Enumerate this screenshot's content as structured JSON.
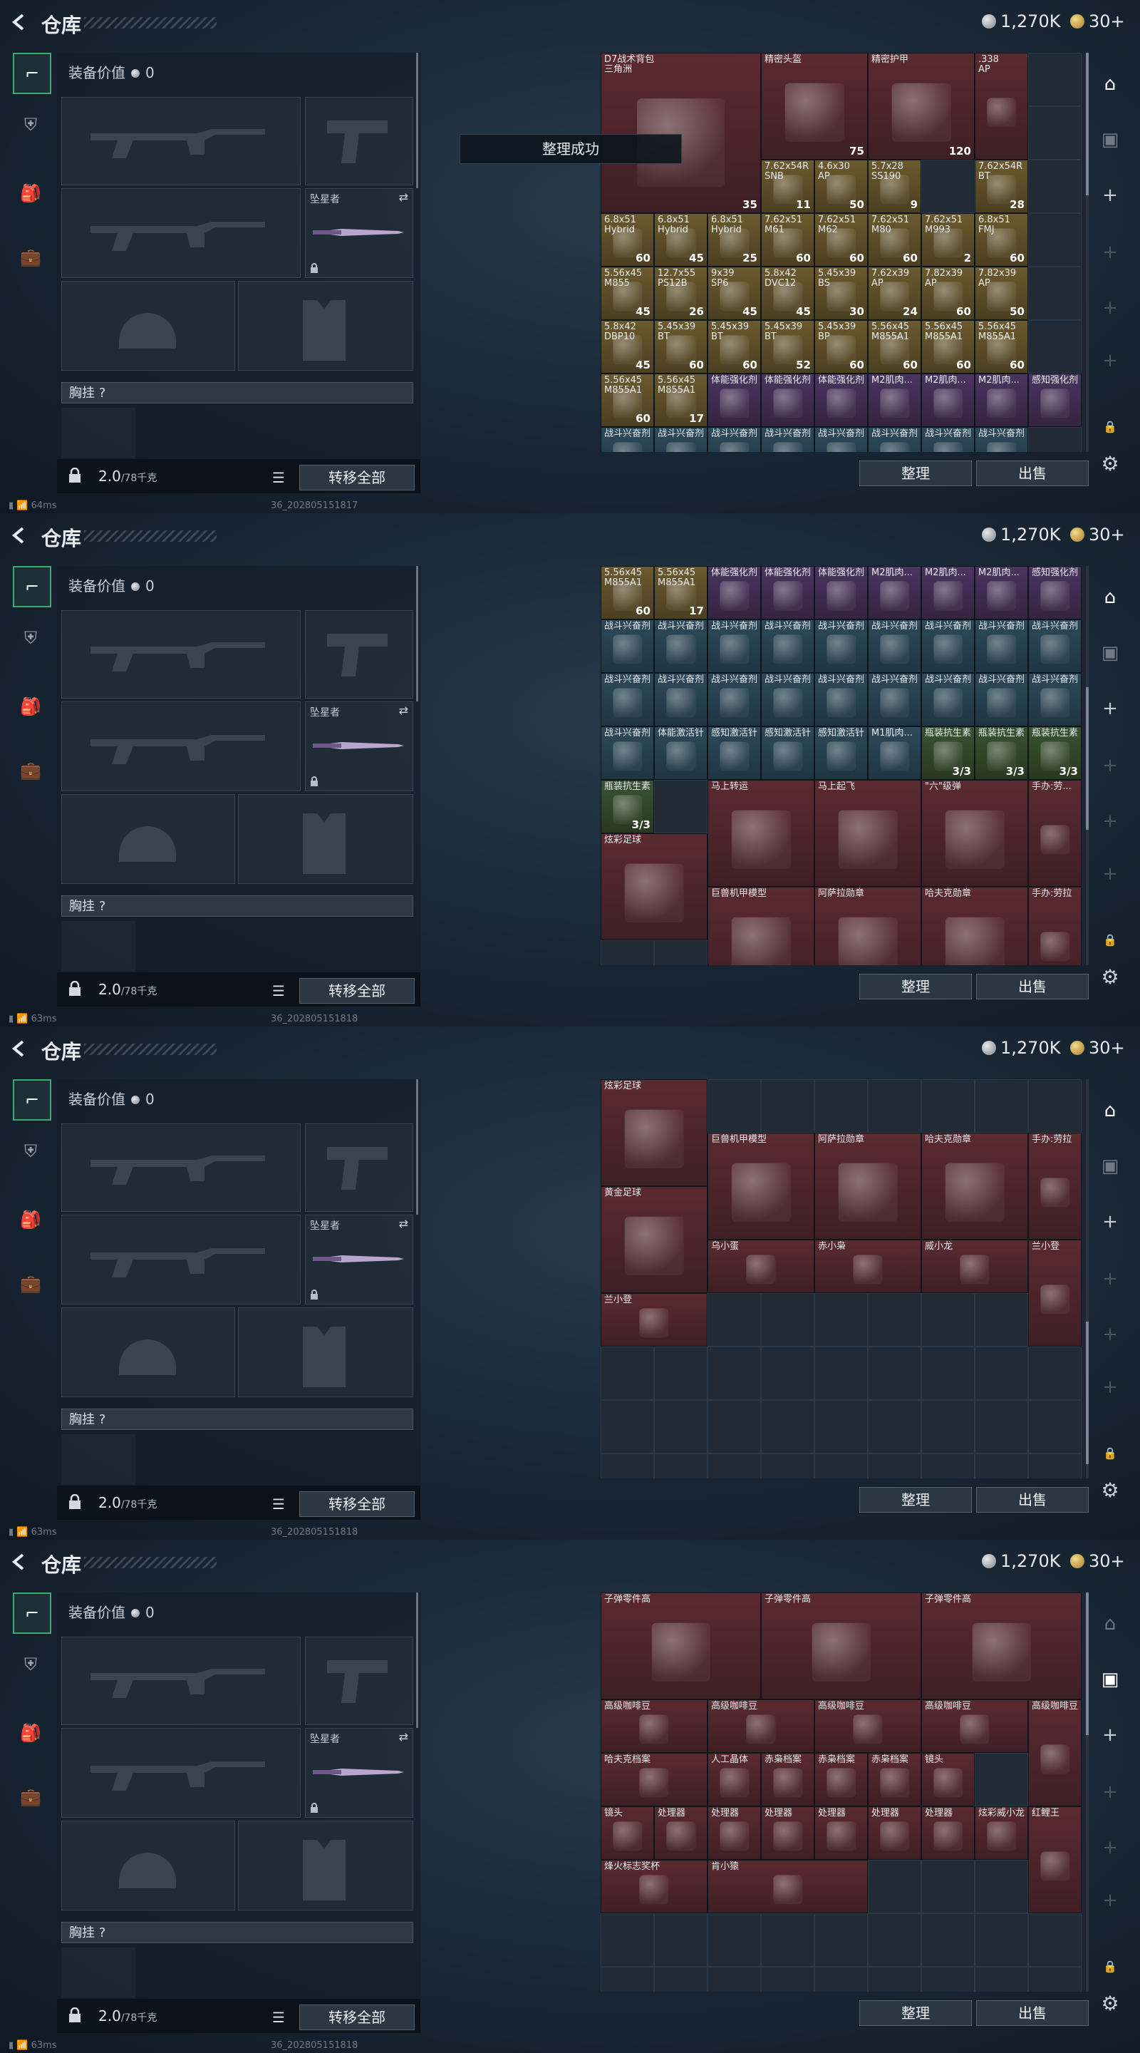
{
  "header": {
    "title": "仓库",
    "silver": "1,270K",
    "gold": "30+"
  },
  "left": {
    "equip_label": "装备价值",
    "equip_value": "0",
    "melee_name": "坠星者",
    "vest_label": "胸挂",
    "vest_q": "?",
    "weight_value": "2.0",
    "weight_max": "/78千克",
    "transfer_label": "转移全部"
  },
  "buttons": {
    "sort": "整理",
    "sell": "出售"
  },
  "toast": "整理成功",
  "screens": [
    {
      "status": "64ms",
      "build": "36_202805151817",
      "cells": [
        {
          "n": "D7战术背包\n三角洲",
          "c": "35",
          "color": "red"
        },
        {
          "n": "精密头盔",
          "c": "75",
          "color": "red"
        },
        {
          "n": "精密护甲",
          "c": "120",
          "color": "red"
        },
        {
          "n": ".338\nAP",
          "c": "",
          "color": "red"
        },
        {
          "n": "7.62x54R\nSNB",
          "c": "11",
          "color": "gold"
        },
        {
          "n": "4.6x30\nAP",
          "c": "50",
          "color": "gold"
        },
        {
          "n": "5.7x28\nSS190",
          "c": "9",
          "color": "gold"
        },
        {
          "n": "7.62x54R\nBT",
          "c": "28",
          "color": "gold"
        },
        {
          "n": "7.62x51\nM61",
          "c": "60",
          "color": "gold"
        },
        {
          "n": "7.62x51\nM62",
          "c": "60",
          "color": "gold"
        },
        {
          "n": "7.62x51\nM80",
          "c": "60",
          "color": "gold"
        },
        {
          "n": "7.62x51\nM993",
          "c": "2",
          "color": "gold"
        },
        {
          "n": "6.8x51\nFMJ",
          "c": "60",
          "color": "gold"
        },
        {
          "n": "6.8x51\nHybrid",
          "c": "60",
          "color": "gold"
        },
        {
          "n": "6.8x51\nHybrid",
          "c": "45",
          "color": "gold"
        },
        {
          "n": "6.8x51\nHybrid",
          "c": "25",
          "color": "gold"
        },
        {
          "n": "5.8x42\nDVC12",
          "c": "45",
          "color": "gold"
        },
        {
          "n": "5.45x39\nBS",
          "c": "30",
          "color": "gold"
        },
        {
          "n": "7.62x39\nAP",
          "c": "24",
          "color": "gold"
        },
        {
          "n": "7.82x39\nAP",
          "c": "60",
          "color": "gold"
        },
        {
          "n": "7.82x39\nAP",
          "c": "50",
          "color": "gold"
        },
        {
          "n": "5.56x45\nM855",
          "c": "45",
          "color": "gold"
        },
        {
          "n": "12.7x55\nPS12B",
          "c": "26",
          "color": "gold"
        },
        {
          "n": "9x39\nSP6",
          "c": "45",
          "color": "gold"
        },
        {
          "n": "5.8x42\nDBP10",
          "c": "45",
          "color": "gold"
        },
        {
          "n": "5.45x39\nBT",
          "c": "60",
          "color": "gold"
        },
        {
          "n": "5.45x39\nBT",
          "c": "60",
          "color": "gold"
        },
        {
          "n": "5.45x39\nBT",
          "c": "52",
          "color": "gold"
        },
        {
          "n": "5.45x39\nBP",
          "c": "60",
          "color": "gold"
        },
        {
          "n": "5.56x45\nM855A1",
          "c": "60",
          "color": "gold"
        },
        {
          "n": "5.56x45\nM855A1",
          "c": "60",
          "color": "gold"
        },
        {
          "n": "5.56x45\nM855A1",
          "c": "60",
          "color": "gold"
        },
        {
          "n": "5.56x45\nM855A1",
          "c": "60",
          "color": "gold"
        },
        {
          "n": "5.56x45\nM855A1",
          "c": "17",
          "color": "gold"
        },
        {
          "n": "体能强化剂",
          "c": "",
          "color": "purple"
        },
        {
          "n": "体能强化剂",
          "c": "",
          "color": "purple"
        },
        {
          "n": "体能强化剂",
          "c": "",
          "color": "purple"
        },
        {
          "n": "M2肌肉...",
          "c": "",
          "color": "purple"
        },
        {
          "n": "M2肌肉...",
          "c": "",
          "color": "purple"
        },
        {
          "n": "M2肌肉...",
          "c": "",
          "color": "purple"
        },
        {
          "n": "感知强化剂",
          "c": "",
          "color": "purple"
        },
        {
          "n": "战斗兴奋剂",
          "c": "",
          "color": "blue"
        },
        {
          "n": "战斗兴奋剂",
          "c": "",
          "color": "blue"
        },
        {
          "n": "战斗兴奋剂",
          "c": "",
          "color": "blue"
        },
        {
          "n": "战斗兴奋剂",
          "c": "",
          "color": "blue"
        },
        {
          "n": "战斗兴奋剂",
          "c": "",
          "color": "blue"
        },
        {
          "n": "战斗兴奋剂",
          "c": "",
          "color": "blue"
        },
        {
          "n": "战斗兴奋剂",
          "c": "",
          "color": "blue"
        },
        {
          "n": "战斗兴奋剂",
          "c": "",
          "color": "blue"
        },
        {
          "n": "战斗兴奋剂",
          "c": "",
          "color": "blue"
        },
        {
          "n": "战斗兴奋剂",
          "c": "",
          "color": "blue"
        },
        {
          "n": "战斗兴奋剂",
          "c": "",
          "color": "blue"
        },
        {
          "n": "战斗兴奋剂",
          "c": "",
          "color": "blue"
        },
        {
          "n": "战斗兴奋剂",
          "c": "",
          "color": "blue"
        },
        {
          "n": "战斗兴奋剂",
          "c": "",
          "color": "blue"
        },
        {
          "n": "战斗兴奋剂",
          "c": "",
          "color": "blue"
        },
        {
          "n": "战斗兴奋剂",
          "c": "",
          "color": "blue"
        },
        {
          "n": "战斗兴奋剂",
          "c": "",
          "color": "blue"
        },
        {
          "n": "战斗兴奋剂",
          "c": "",
          "color": "blue"
        },
        {
          "n": "战斗兴奋剂",
          "c": "",
          "color": "blue"
        },
        {
          "n": "战斗兴奋剂",
          "c": "",
          "color": "blue"
        },
        {
          "n": "战斗兴奋剂",
          "c": "",
          "color": "blue"
        },
        {
          "n": "战斗兴奋剂",
          "c": "",
          "color": "blue"
        },
        {
          "n": "战斗兴奋剂",
          "c": "",
          "color": "blue"
        },
        {
          "n": "战斗兴奋剂",
          "c": "",
          "color": "blue"
        },
        {
          "n": "战斗兴奋剂",
          "c": "",
          "color": "blue"
        },
        {
          "n": "战斗兴奋剂",
          "c": "",
          "color": "blue"
        }
      ]
    },
    {
      "status": "63ms",
      "build": "36_202805151818",
      "cells": [
        {
          "n": "5.56x45\nM855A1",
          "c": "60",
          "color": "gold"
        },
        {
          "n": "5.56x45\nM855A1",
          "c": "17",
          "color": "gold"
        },
        {
          "n": "体能强化剂",
          "c": "",
          "color": "purple"
        },
        {
          "n": "体能强化剂",
          "c": "",
          "color": "purple"
        },
        {
          "n": "体能强化剂",
          "c": "",
          "color": "purple"
        },
        {
          "n": "M2肌肉...",
          "c": "",
          "color": "purple"
        },
        {
          "n": "M2肌肉...",
          "c": "",
          "color": "purple"
        },
        {
          "n": "M2肌肉...",
          "c": "",
          "color": "purple"
        },
        {
          "n": "感知强化剂",
          "c": "",
          "color": "purple"
        },
        {
          "n": "战斗兴奋剂",
          "c": "",
          "color": "blue"
        },
        {
          "n": "战斗兴奋剂",
          "c": "",
          "color": "blue"
        },
        {
          "n": "战斗兴奋剂",
          "c": "",
          "color": "blue"
        },
        {
          "n": "战斗兴奋剂",
          "c": "",
          "color": "blue"
        },
        {
          "n": "战斗兴奋剂",
          "c": "",
          "color": "blue"
        },
        {
          "n": "战斗兴奋剂",
          "c": "",
          "color": "blue"
        },
        {
          "n": "战斗兴奋剂",
          "c": "",
          "color": "blue"
        },
        {
          "n": "战斗兴奋剂",
          "c": "",
          "color": "blue"
        },
        {
          "n": "战斗兴奋剂",
          "c": "",
          "color": "blue"
        },
        {
          "n": "战斗兴奋剂",
          "c": "",
          "color": "blue"
        },
        {
          "n": "战斗兴奋剂",
          "c": "",
          "color": "blue"
        },
        {
          "n": "战斗兴奋剂",
          "c": "",
          "color": "blue"
        },
        {
          "n": "战斗兴奋剂",
          "c": "",
          "color": "blue"
        },
        {
          "n": "战斗兴奋剂",
          "c": "",
          "color": "blue"
        },
        {
          "n": "战斗兴奋剂",
          "c": "",
          "color": "blue"
        },
        {
          "n": "战斗兴奋剂",
          "c": "",
          "color": "blue"
        },
        {
          "n": "战斗兴奋剂",
          "c": "",
          "color": "blue"
        },
        {
          "n": "战斗兴奋剂",
          "c": "",
          "color": "blue"
        },
        {
          "n": "战斗兴奋剂",
          "c": "",
          "color": "blue"
        },
        {
          "n": "体能激活针",
          "c": "",
          "color": "blue"
        },
        {
          "n": "感知激活针",
          "c": "",
          "color": "blue"
        },
        {
          "n": "感知激活针",
          "c": "",
          "color": "blue"
        },
        {
          "n": "感知激活针",
          "c": "",
          "color": "blue"
        },
        {
          "n": "M1肌肉...",
          "c": "",
          "color": "blue"
        },
        {
          "n": "瓶装抗生素",
          "c": "3/3",
          "color": "green"
        },
        {
          "n": "瓶装抗生素",
          "c": "3/3",
          "color": "green"
        },
        {
          "n": "瓶装抗生素",
          "c": "3/3",
          "color": "green"
        },
        {
          "n": "瓶装抗生素",
          "c": "3/3",
          "color": "green"
        },
        {
          "n": "马上转运",
          "c": "",
          "color": "red"
        },
        {
          "n": "马上起飞",
          "c": "",
          "color": "red"
        },
        {
          "n": "\"六\"级弹",
          "c": "",
          "color": "red"
        },
        {
          "n": "手办:劳...",
          "c": "",
          "color": "red"
        },
        {
          "n": "炫彩足球",
          "c": "",
          "color": "red"
        },
        {
          "n": "巨兽机甲模型",
          "c": "",
          "color": "red"
        },
        {
          "n": "阿萨拉勋章",
          "c": "",
          "color": "red"
        },
        {
          "n": "哈夫克勋章",
          "c": "",
          "color": "red"
        },
        {
          "n": "手办:劳拉",
          "c": "",
          "color": "red"
        }
      ]
    },
    {
      "status": "63ms",
      "build": "36_202805151818",
      "cells": [
        {
          "n": "炫彩足球",
          "c": "",
          "color": "red"
        },
        {
          "n": "巨兽机甲模型",
          "c": "",
          "color": "red"
        },
        {
          "n": "阿萨拉勋章",
          "c": "",
          "color": "red"
        },
        {
          "n": "哈夫克勋章",
          "c": "",
          "color": "red"
        },
        {
          "n": "手办:劳拉",
          "c": "",
          "color": "red"
        },
        {
          "n": "黄金足球",
          "c": "",
          "color": "red"
        },
        {
          "n": "乌小蛋",
          "c": "",
          "color": "red"
        },
        {
          "n": "赤小枭",
          "c": "",
          "color": "red"
        },
        {
          "n": "威小龙",
          "c": "",
          "color": "red"
        },
        {
          "n": "兰小登",
          "c": "",
          "color": "red"
        },
        {
          "n": "兰小登",
          "c": "",
          "color": "red"
        }
      ]
    },
    {
      "status": "63ms",
      "build": "36_202805151818",
      "cells": [
        {
          "n": "子弹零件高",
          "c": "",
          "color": "red"
        },
        {
          "n": "子弹零件高",
          "c": "",
          "color": "red"
        },
        {
          "n": "子弹零件高",
          "c": "",
          "color": "red"
        },
        {
          "n": "高级咖啡豆",
          "c": "",
          "color": "red"
        },
        {
          "n": "高级咖啡豆",
          "c": "",
          "color": "red"
        },
        {
          "n": "高级咖啡豆",
          "c": "",
          "color": "red"
        },
        {
          "n": "高级咖啡豆",
          "c": "",
          "color": "red"
        },
        {
          "n": "高级咖啡豆",
          "c": "",
          "color": "red"
        },
        {
          "n": "哈夫克档案",
          "c": "",
          "color": "red"
        },
        {
          "n": "人工晶体",
          "c": "",
          "color": "red"
        },
        {
          "n": "赤枭档案",
          "c": "",
          "color": "red"
        },
        {
          "n": "赤枭档案",
          "c": "",
          "color": "red"
        },
        {
          "n": "赤枭档案",
          "c": "",
          "color": "red"
        },
        {
          "n": "镜头",
          "c": "",
          "color": "red"
        },
        {
          "n": "镜头",
          "c": "",
          "color": "red"
        },
        {
          "n": "处理器",
          "c": "",
          "color": "red"
        },
        {
          "n": "处理器",
          "c": "",
          "color": "red"
        },
        {
          "n": "处理器",
          "c": "",
          "color": "red"
        },
        {
          "n": "处理器",
          "c": "",
          "color": "red"
        },
        {
          "n": "处理器",
          "c": "",
          "color": "red"
        },
        {
          "n": "处理器",
          "c": "",
          "color": "red"
        },
        {
          "n": "炫彩威小龙",
          "c": "",
          "color": "red"
        },
        {
          "n": "红鲤王",
          "c": "",
          "color": "red"
        },
        {
          "n": "烽火标志奖杯",
          "c": "",
          "color": "red"
        },
        {
          "n": "肯小猿",
          "c": "",
          "color": "red"
        }
      ]
    }
  ]
}
